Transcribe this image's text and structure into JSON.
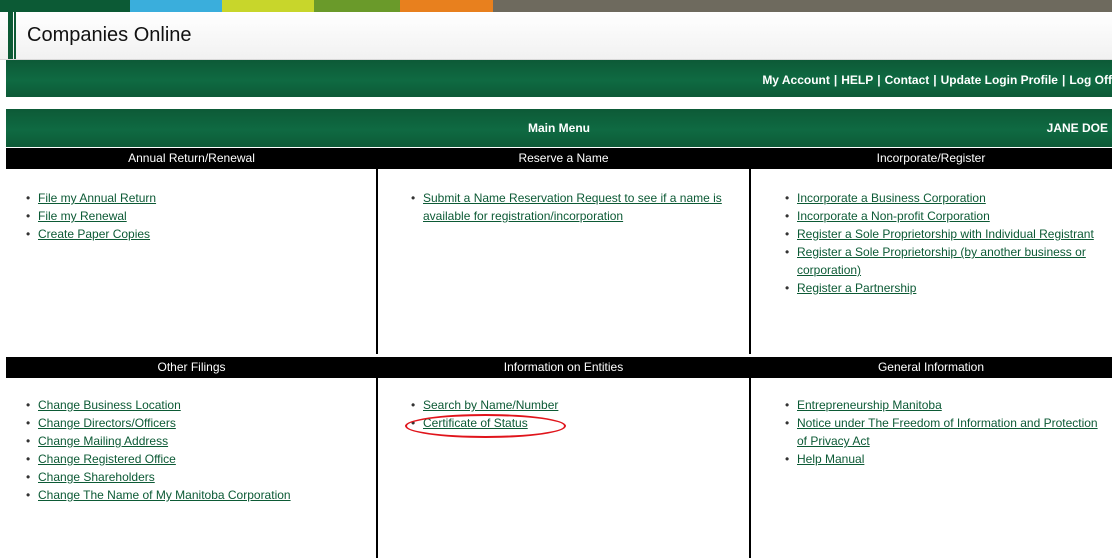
{
  "app": {
    "title": "Companies Online"
  },
  "nav": {
    "links": [
      "My Account",
      "HELP",
      "Contact",
      "Update Login Profile",
      "Log Off"
    ],
    "separator": "|"
  },
  "menu": {
    "title": "Main Menu",
    "user": "JANE DOE",
    "sections": [
      {
        "heading": "Annual Return/Renewal",
        "links": [
          "File my Annual Return",
          "File my Renewal",
          "Create Paper Copies"
        ]
      },
      {
        "heading": "Reserve a Name",
        "links": [
          "Submit a Name Reservation Request to see if a name is available for registration/incorporation"
        ]
      },
      {
        "heading": "Incorporate/Register",
        "links": [
          "Incorporate a Business Corporation",
          "Incorporate a Non-profit Corporation",
          "Register a Sole Proprietorship with Individual Registrant",
          "Register a Sole Proprietorship (by another business or corporation)",
          "Register a Partnership"
        ]
      },
      {
        "heading": "Other Filings",
        "links": [
          "Change Business Location",
          "Change Directors/Officers",
          "Change Mailing Address",
          "Change Registered Office",
          "Change Shareholders",
          "Change The Name of My Manitoba Corporation"
        ]
      },
      {
        "heading": "Information on Entities",
        "links": [
          "Search by Name/Number",
          "Certificate of Status"
        ]
      },
      {
        "heading": "General Information",
        "links": [
          "Entrepreneurship Manitoba",
          "Notice under The Freedom of Information and Protection of Privacy Act",
          "Help Manual"
        ]
      }
    ]
  },
  "colors": {
    "brand_green": "#0d5a37",
    "link_green": "#0c5a35",
    "section_black": "#000000",
    "highlight_red": "#e0141b",
    "stripe": [
      "#0c5a35",
      "#3aaedc",
      "#c8d62b",
      "#6a9a2a",
      "#e8801e",
      "#6e6a5e"
    ]
  }
}
